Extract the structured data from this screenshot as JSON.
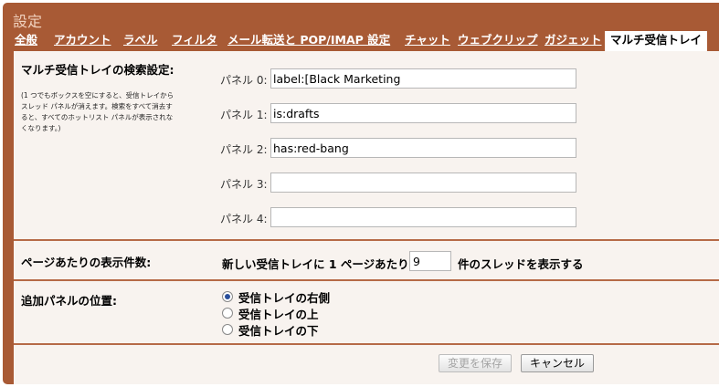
{
  "window": {
    "title": "設定"
  },
  "tabs": [
    {
      "label": "全般",
      "active": false
    },
    {
      "label": "アカウント",
      "active": false
    },
    {
      "label": "ラベル",
      "active": false
    },
    {
      "label": "フィルタ",
      "active": false
    },
    {
      "label": "メール転送と POP/IMAP 設定",
      "active": false
    },
    {
      "label": "チャット",
      "active": false
    },
    {
      "label": "ウェブクリップ",
      "active": false
    },
    {
      "label": "ガジェット",
      "active": false
    },
    {
      "label": "マルチ受信トレイ",
      "active": true
    }
  ],
  "search_section": {
    "title": "マルチ受信トレイの検索設定:",
    "note": "(1 つでもボックスを空にすると、受信トレイからスレッド パネルが消えます。検索をすべて消去すると、すべてのホットリスト パネルが表示されなくなります。)",
    "panels": [
      {
        "label": "パネル 0:",
        "value": "label:[Black Marketing"
      },
      {
        "label": "パネル 1:",
        "value": "is:drafts"
      },
      {
        "label": "パネル 2:",
        "value": "has:red-bang"
      },
      {
        "label": "パネル 3:",
        "value": ""
      },
      {
        "label": "パネル 4:",
        "value": ""
      }
    ]
  },
  "per_page_section": {
    "title": "ページあたりの表示件数:",
    "prefix": "新しい受信トレイに 1 ページあたり",
    "value": "9",
    "suffix": "件のスレッドを表示する"
  },
  "position_section": {
    "title": "追加パネルの位置:",
    "options": [
      {
        "label": "受信トレイの右側",
        "checked": true
      },
      {
        "label": "受信トレイの上",
        "checked": false
      },
      {
        "label": "受信トレイの下",
        "checked": false
      }
    ]
  },
  "footer": {
    "save_label": "変更を保存",
    "cancel_label": "キャンセル"
  }
}
